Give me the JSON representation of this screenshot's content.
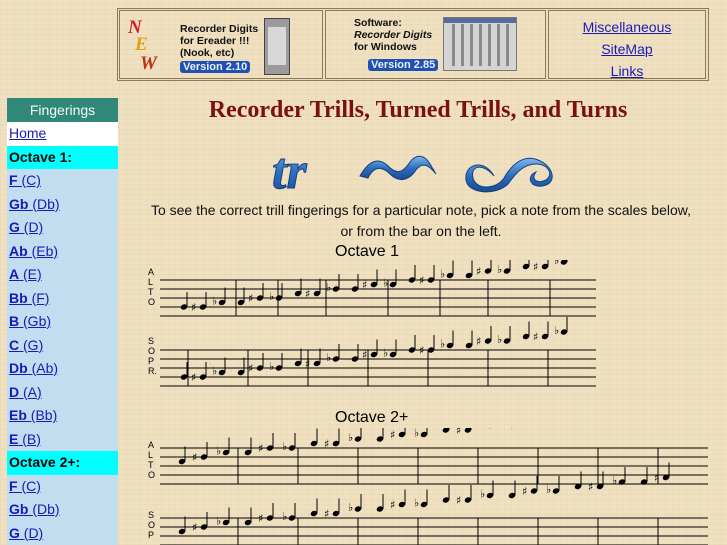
{
  "banner": {
    "ereader": {
      "new_letters": [
        "N",
        "E",
        "W"
      ],
      "lines": [
        "Recorder Digits",
        "for Ereader !!!",
        "(Nook, etc)"
      ],
      "version": "Version 2.10"
    },
    "windows": {
      "lines": [
        "Software:",
        "Recorder Digits",
        "for Windows"
      ],
      "version": "Version 2.85"
    },
    "links": [
      "Miscellaneous",
      "SiteMap",
      "Links"
    ]
  },
  "sidebar": {
    "heading": "Fingerings",
    "home": "Home",
    "groups": [
      {
        "label": "Octave 1:",
        "notes": [
          {
            "name": "F",
            "alt": "(C)"
          },
          {
            "name": "Gb",
            "alt": "(Db)"
          },
          {
            "name": "G",
            "alt": "(D)"
          },
          {
            "name": "Ab",
            "alt": "(Eb)"
          },
          {
            "name": "A",
            "alt": "(E)"
          },
          {
            "name": "Bb",
            "alt": "(F)"
          },
          {
            "name": "B",
            "alt": "(Gb)"
          },
          {
            "name": "C",
            "alt": "(G)"
          },
          {
            "name": "Db",
            "alt": "(Ab)"
          },
          {
            "name": "D",
            "alt": "(A)"
          },
          {
            "name": "Eb",
            "alt": "(Bb)"
          },
          {
            "name": "E",
            "alt": "(B)"
          }
        ]
      },
      {
        "label": "Octave 2+:",
        "notes": [
          {
            "name": "F",
            "alt": "(C)"
          },
          {
            "name": "Gb",
            "alt": "(Db)"
          },
          {
            "name": "G",
            "alt": "(D)"
          }
        ]
      }
    ]
  },
  "main": {
    "title": "Recorder Trills, Turned Trills, and Turns",
    "ornament_glyph": "tr",
    "intro": "To see the correct trill fingerings for a particular note, pick a note from the scales below, or from the bar on the left.",
    "sections": [
      {
        "title": "Octave 1",
        "alto_letters": [
          "A",
          "L",
          "T",
          "O"
        ],
        "soprano_letters": [
          "S",
          "O",
          "P",
          "R."
        ]
      },
      {
        "title": "Octave 2+",
        "alto_letters": [
          "A",
          "L",
          "T",
          "O"
        ],
        "soprano_letters": [
          "S",
          "O",
          "P"
        ]
      }
    ]
  },
  "colors": {
    "background": "#efe0c0",
    "title": "#7a1010",
    "link": "#1a1ab8",
    "sidebar": "#c2dcf0",
    "sidebar_heading": "#308878",
    "octave_highlight": "#00ffff",
    "ornament_blue": "#2e6fc0"
  }
}
